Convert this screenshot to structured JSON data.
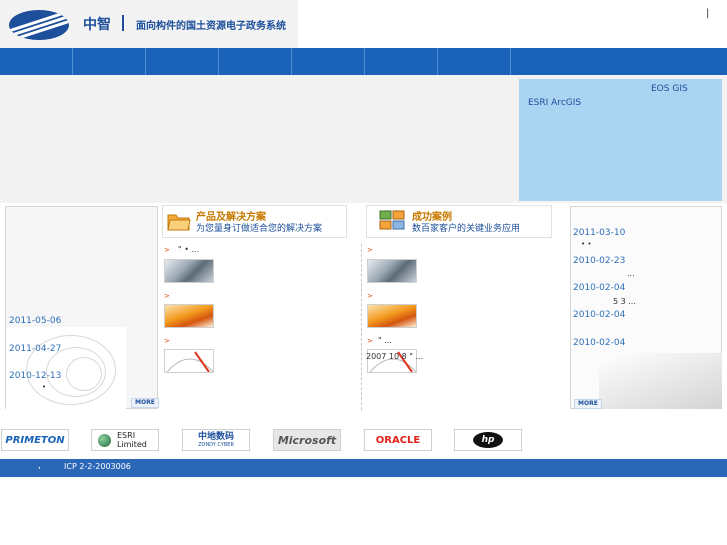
{
  "header": {
    "brand_name": "中智",
    "slogan": "面向构件的国土资源电子政务系统",
    "top_mark": "|"
  },
  "nav": {
    "items": [
      "",
      "",
      "",
      "",
      "",
      "",
      "",
      ""
    ]
  },
  "banner": {
    "eos_text": "EOS  GIS",
    "esri_text": "ESRI ArcGIS"
  },
  "news_left": {
    "items": [
      {
        "date": "2011-05-06"
      },
      {
        "date": "2011-04-27"
      },
      {
        "date": "2010-12-13"
      }
    ],
    "dots": "•",
    "more": "MORE"
  },
  "products": {
    "title": "产品及解决方案",
    "subtitle": "为您量身订做适合您的解决方案",
    "bullet": ">",
    "rows": [
      {
        "text": "\"  •      ..."
      },
      {
        "text": ""
      },
      {
        "text": ""
      }
    ]
  },
  "cases": {
    "title": "成功案例",
    "subtitle": "数百家客户的关键业务应用",
    "bullet": ">",
    "rows": [
      {
        "text": ""
      },
      {
        "text": ""
      },
      {
        "text": "\"          ..."
      }
    ],
    "overlay_text": "2007  10  8   \"       ..."
  },
  "news_right": {
    "items": [
      {
        "date": "2011-03-10",
        "text": "• •"
      },
      {
        "date": "2010-02-23",
        "text": "..."
      },
      {
        "date": "2010-02-04",
        "text": "5   3   ..."
      },
      {
        "date": "2010-02-04",
        "text": ""
      },
      {
        "date": "2010-02-04",
        "text": ""
      }
    ],
    "more": "MORE"
  },
  "partners": {
    "primeton": "PRIMETON",
    "esri_line1": "ESRI",
    "esri_line2": "Limited",
    "zondy_cn": "中地数码",
    "zondy_en": "ZONDY CYBER",
    "microsoft": "Microsoft",
    "oracle": "ORACLE",
    "hp": "hp"
  },
  "footer": {
    "comma": ",",
    "icp": "ICP 2-2-2003006"
  },
  "colors": {
    "nav": "#1b63b8",
    "banner_info": "#abd3f2",
    "footer": "#2a68b7",
    "accent_orange": "#c87a00"
  }
}
